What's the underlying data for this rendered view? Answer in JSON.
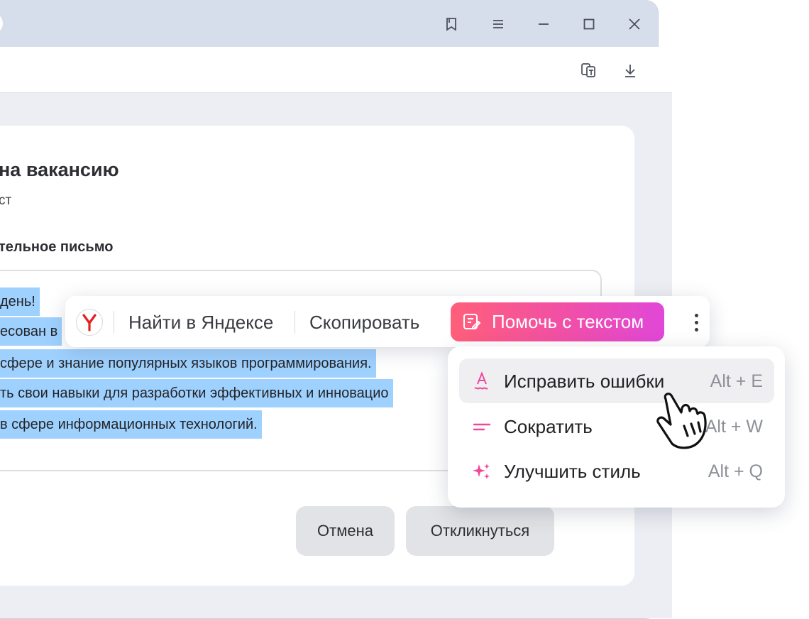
{
  "window": {
    "controls": [
      {
        "name": "bookmarks-icon"
      },
      {
        "name": "menu-icon"
      },
      {
        "name": "minimize-icon"
      },
      {
        "name": "maximize-icon"
      },
      {
        "name": "close-icon"
      }
    ]
  },
  "toolbar": {
    "icons": [
      "translate-icon",
      "download-icon"
    ]
  },
  "form": {
    "title": "на вакансию",
    "subtitle": "ст",
    "field_label": "тельное письмо",
    "text_lines": [
      "день!",
      "есован в",
      "сфере и знание популярных языков программирования.",
      "ть свои навыки для разработки эффективных и инновацио",
      "в сфере информационных технологий."
    ],
    "cancel_label": "Отмена",
    "submit_label": "Откликнуться"
  },
  "context_popup": {
    "search_label": "Найти в Яндексе",
    "copy_label": "Скопировать",
    "help_label": "Помочь с текстом",
    "accent_gradient": [
      "#ff5f7a",
      "#e147d8"
    ]
  },
  "text_menu": {
    "items": [
      {
        "label": "Исправить ошибки",
        "shortcut": "Alt + E",
        "icon": "spellcheck-icon"
      },
      {
        "label": "Сократить",
        "shortcut": "Alt + W",
        "icon": "shorten-icon"
      },
      {
        "label": "Улучшить стиль",
        "shortcut": "Alt + Q",
        "icon": "sparkle-icon"
      }
    ]
  },
  "colors": {
    "selection": "#9fd1ff",
    "window_frame": "#d6deec",
    "menu_icon_pink": "#f0479a"
  }
}
